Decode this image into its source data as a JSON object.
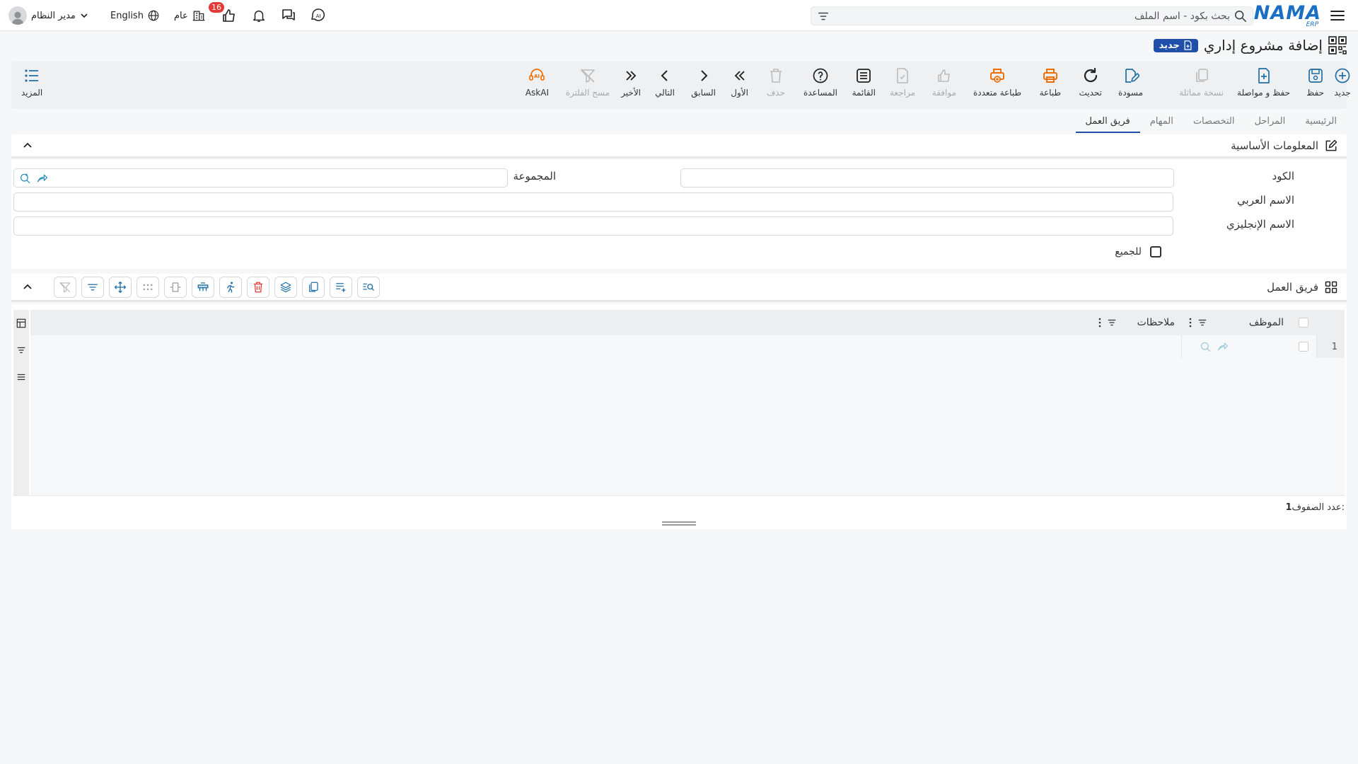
{
  "topbar": {
    "logo_main": "NAMA",
    "logo_sub": "ERP",
    "search_placeholder": "بحث بكود - اسم الملف",
    "notification_count": "16",
    "branch_label": "عام",
    "language_label": "English",
    "user_name": "مدير النظام"
  },
  "page": {
    "title": "إضافة مشروع إداري",
    "status_badge": "جديد"
  },
  "toolbar": {
    "new": "جديد",
    "save": "حفظ",
    "save_continue": "حفظ و مواصلة",
    "duplicate": "نسخة مماثلة",
    "draft": "مسودة",
    "refresh": "تحديث",
    "print": "طباعة",
    "multi_print": "طباعة متعددة",
    "approve": "موافقة",
    "review": "مراجعة",
    "list": "القائمة",
    "help": "المساعدة",
    "delete": "حذف",
    "first": "الأول",
    "previous": "السابق",
    "next": "التالي",
    "last": "الأخير",
    "clear_filter": "مسح الفلترة",
    "ask_ai": "AskAI",
    "more": "المزيد"
  },
  "tabs": [
    {
      "label": "الرئيسية",
      "active": false
    },
    {
      "label": "المراحل",
      "active": false
    },
    {
      "label": "التخصصات",
      "active": false
    },
    {
      "label": "المهام",
      "active": false
    },
    {
      "label": "فريق العمل",
      "active": true
    }
  ],
  "basic_info": {
    "title": "المعلومات الأساسية",
    "code_label": "الكود",
    "code_value": "",
    "group_label": "المجموعة",
    "group_value": "",
    "arabic_name_label": "الاسم العربي",
    "arabic_name_value": "",
    "english_name_label": "الاسم الإنجليزي",
    "english_name_value": "",
    "for_all_label": "للجميع",
    "for_all_checked": false
  },
  "team": {
    "title": "فريق العمل",
    "columns": [
      "الموظف",
      "ملاحظات"
    ],
    "rows": [
      {
        "index": "1",
        "employee": "",
        "notes": ""
      }
    ],
    "row_count_label": "عدد الصفوف:",
    "row_count": "1"
  },
  "colors": {
    "accent": "#1f4fa8",
    "logo": "#1a6fc2",
    "grid_icon": "#1f6fa5",
    "print_orange": "#ef6c00",
    "danger": "#e53935"
  }
}
